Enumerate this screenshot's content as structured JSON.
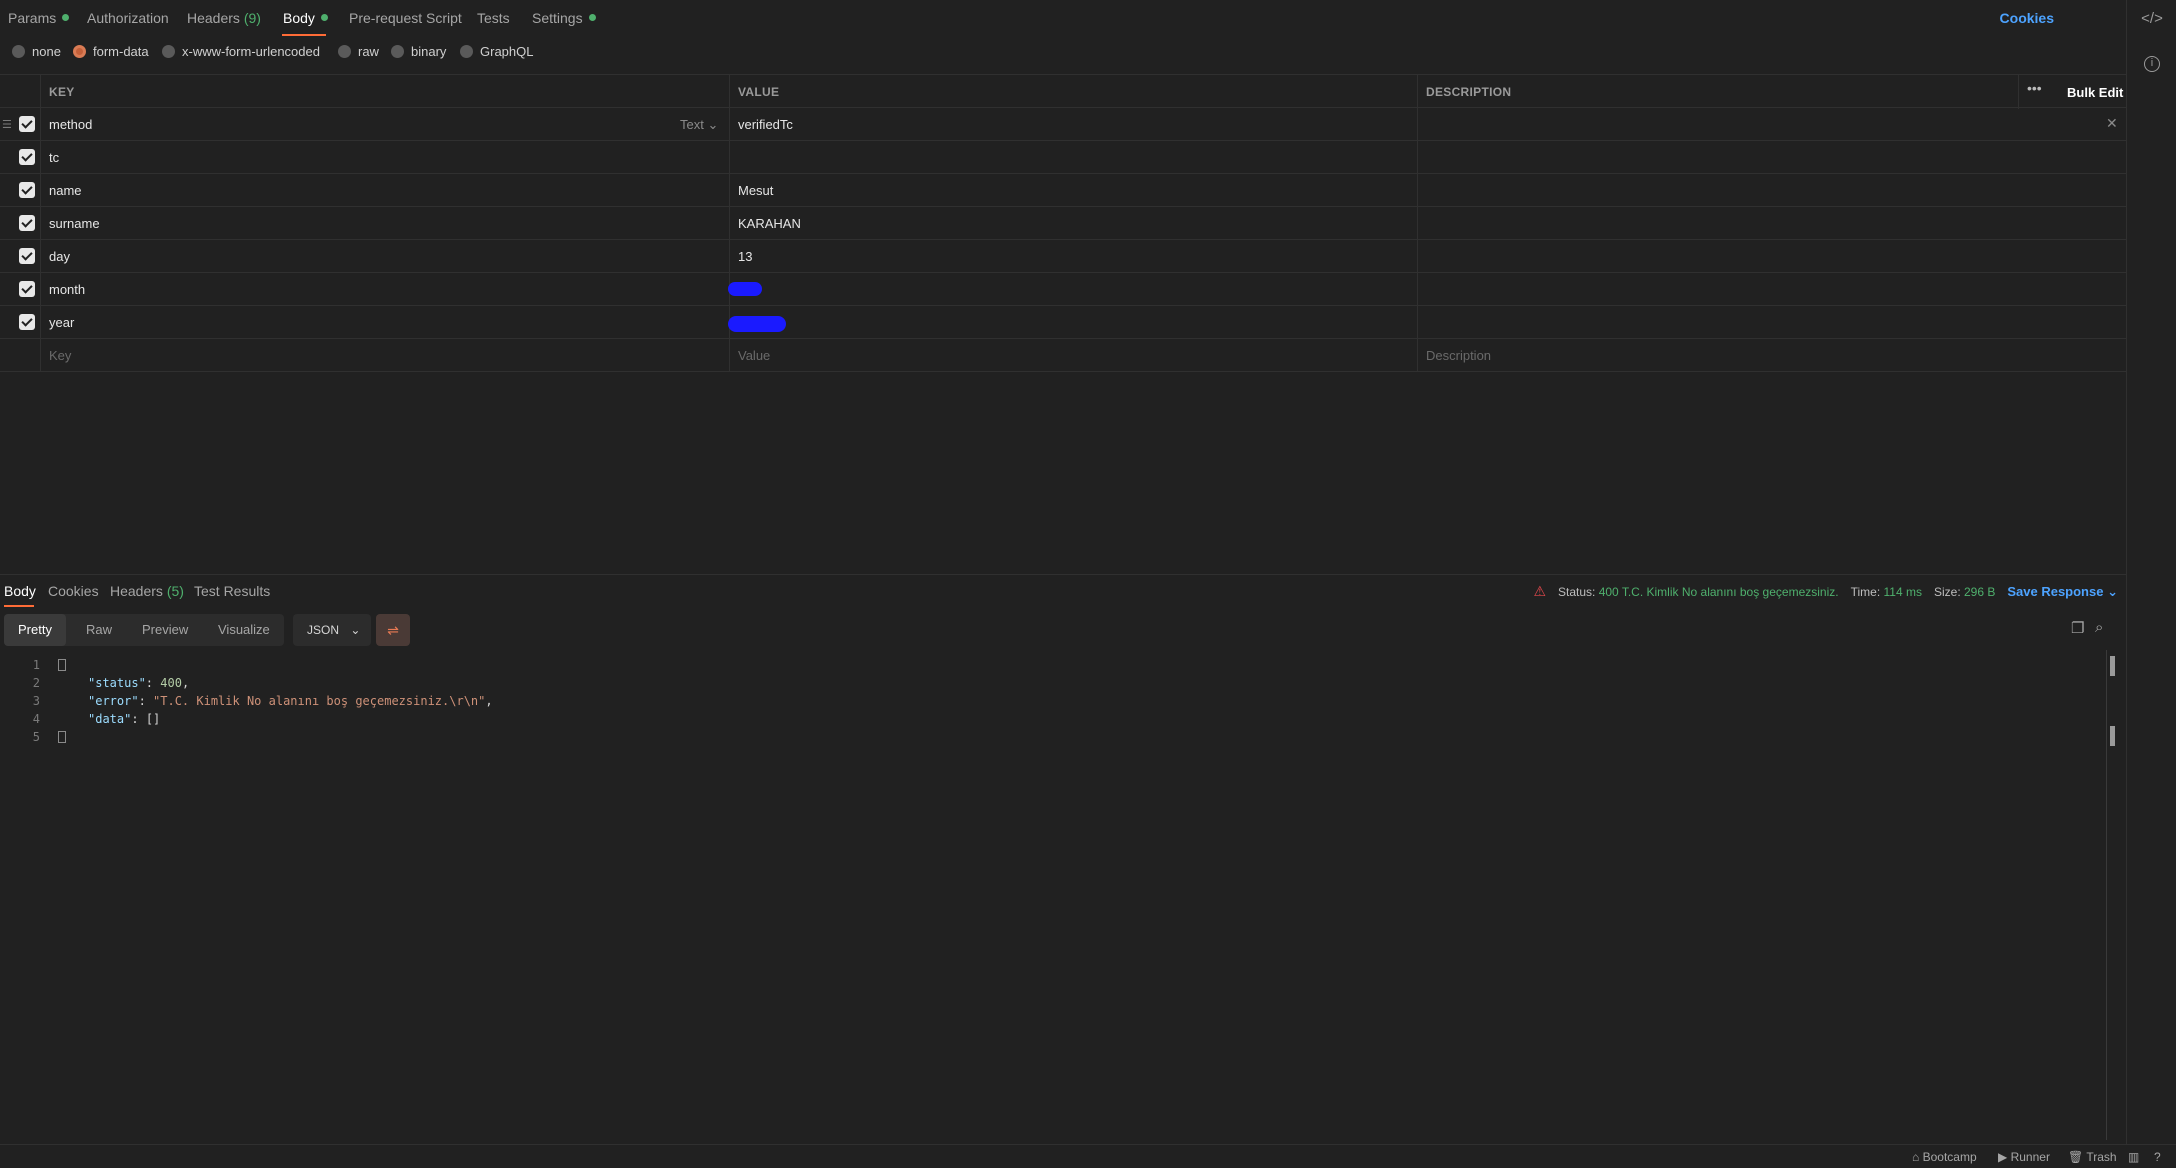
{
  "request_tabs": [
    {
      "label": "Params",
      "dot": true
    },
    {
      "label": "Authorization"
    },
    {
      "label": "Headers",
      "count": "(9)"
    },
    {
      "label": "Body",
      "dot": true,
      "active": true
    },
    {
      "label": "Pre-request Script"
    },
    {
      "label": "Tests"
    },
    {
      "label": "Settings",
      "dot": true
    }
  ],
  "cookies_label": "Cookies",
  "body_types": [
    {
      "label": "none",
      "selected": false
    },
    {
      "label": "form-data",
      "selected": true
    },
    {
      "label": "x-www-form-urlencoded",
      "selected": false
    },
    {
      "label": "raw",
      "selected": false
    },
    {
      "label": "binary",
      "selected": false
    },
    {
      "label": "GraphQL",
      "selected": false
    }
  ],
  "table": {
    "headers": {
      "key": "KEY",
      "value": "VALUE",
      "description": "DESCRIPTION"
    },
    "bulk_edit": "Bulk Edit",
    "type_label": "Text",
    "rows": [
      {
        "key": "method",
        "value": "verifiedTc",
        "checked": true
      },
      {
        "key": "tc",
        "value": "",
        "checked": true
      },
      {
        "key": "name",
        "value": "Mesut",
        "checked": true
      },
      {
        "key": "surname",
        "value": "KARAHAN",
        "checked": true
      },
      {
        "key": "day",
        "value": "13",
        "checked": true
      },
      {
        "key": "month",
        "value": "",
        "checked": true,
        "redacted": true
      },
      {
        "key": "year",
        "value": "",
        "checked": true,
        "redacted": true
      }
    ],
    "placeholders": {
      "key": "Key",
      "value": "Value",
      "description": "Description"
    }
  },
  "response": {
    "tabs": [
      {
        "label": "Body",
        "active": true
      },
      {
        "label": "Cookies"
      },
      {
        "label": "Headers",
        "count": "(5)"
      },
      {
        "label": "Test Results"
      }
    ],
    "status_label": "Status:",
    "status_value": "400 T.C. Kimlik No alanını boş geçemezsiniz.",
    "time_label": "Time:",
    "time_value": "114 ms",
    "size_label": "Size:",
    "size_value": "296 B",
    "save_response": "Save Response",
    "view_modes": [
      "Pretty",
      "Raw",
      "Preview",
      "Visualize"
    ],
    "active_view": "Pretty",
    "format": "JSON",
    "code_lines": [
      {
        "n": "1",
        "text": "{"
      },
      {
        "n": "2",
        "key": "\"status\"",
        "sep": ": ",
        "val": "400",
        "end": ","
      },
      {
        "n": "3",
        "key": "\"error\"",
        "sep": ": ",
        "val": "\"T.C. Kimlik No alanını boş geçemezsiniz.\\r\\n\"",
        "end": ","
      },
      {
        "n": "4",
        "key": "\"data\"",
        "sep": ": ",
        "val": "[]",
        "end": ""
      },
      {
        "n": "5",
        "text": "}"
      }
    ]
  },
  "statusbar": {
    "bootcamp": "Bootcamp",
    "runner": "Runner",
    "trash": "Trash"
  },
  "colors": {
    "accent": "#ff6c37",
    "success": "#4fb06d",
    "link": "#4da3ff",
    "error": "#e5484d"
  }
}
